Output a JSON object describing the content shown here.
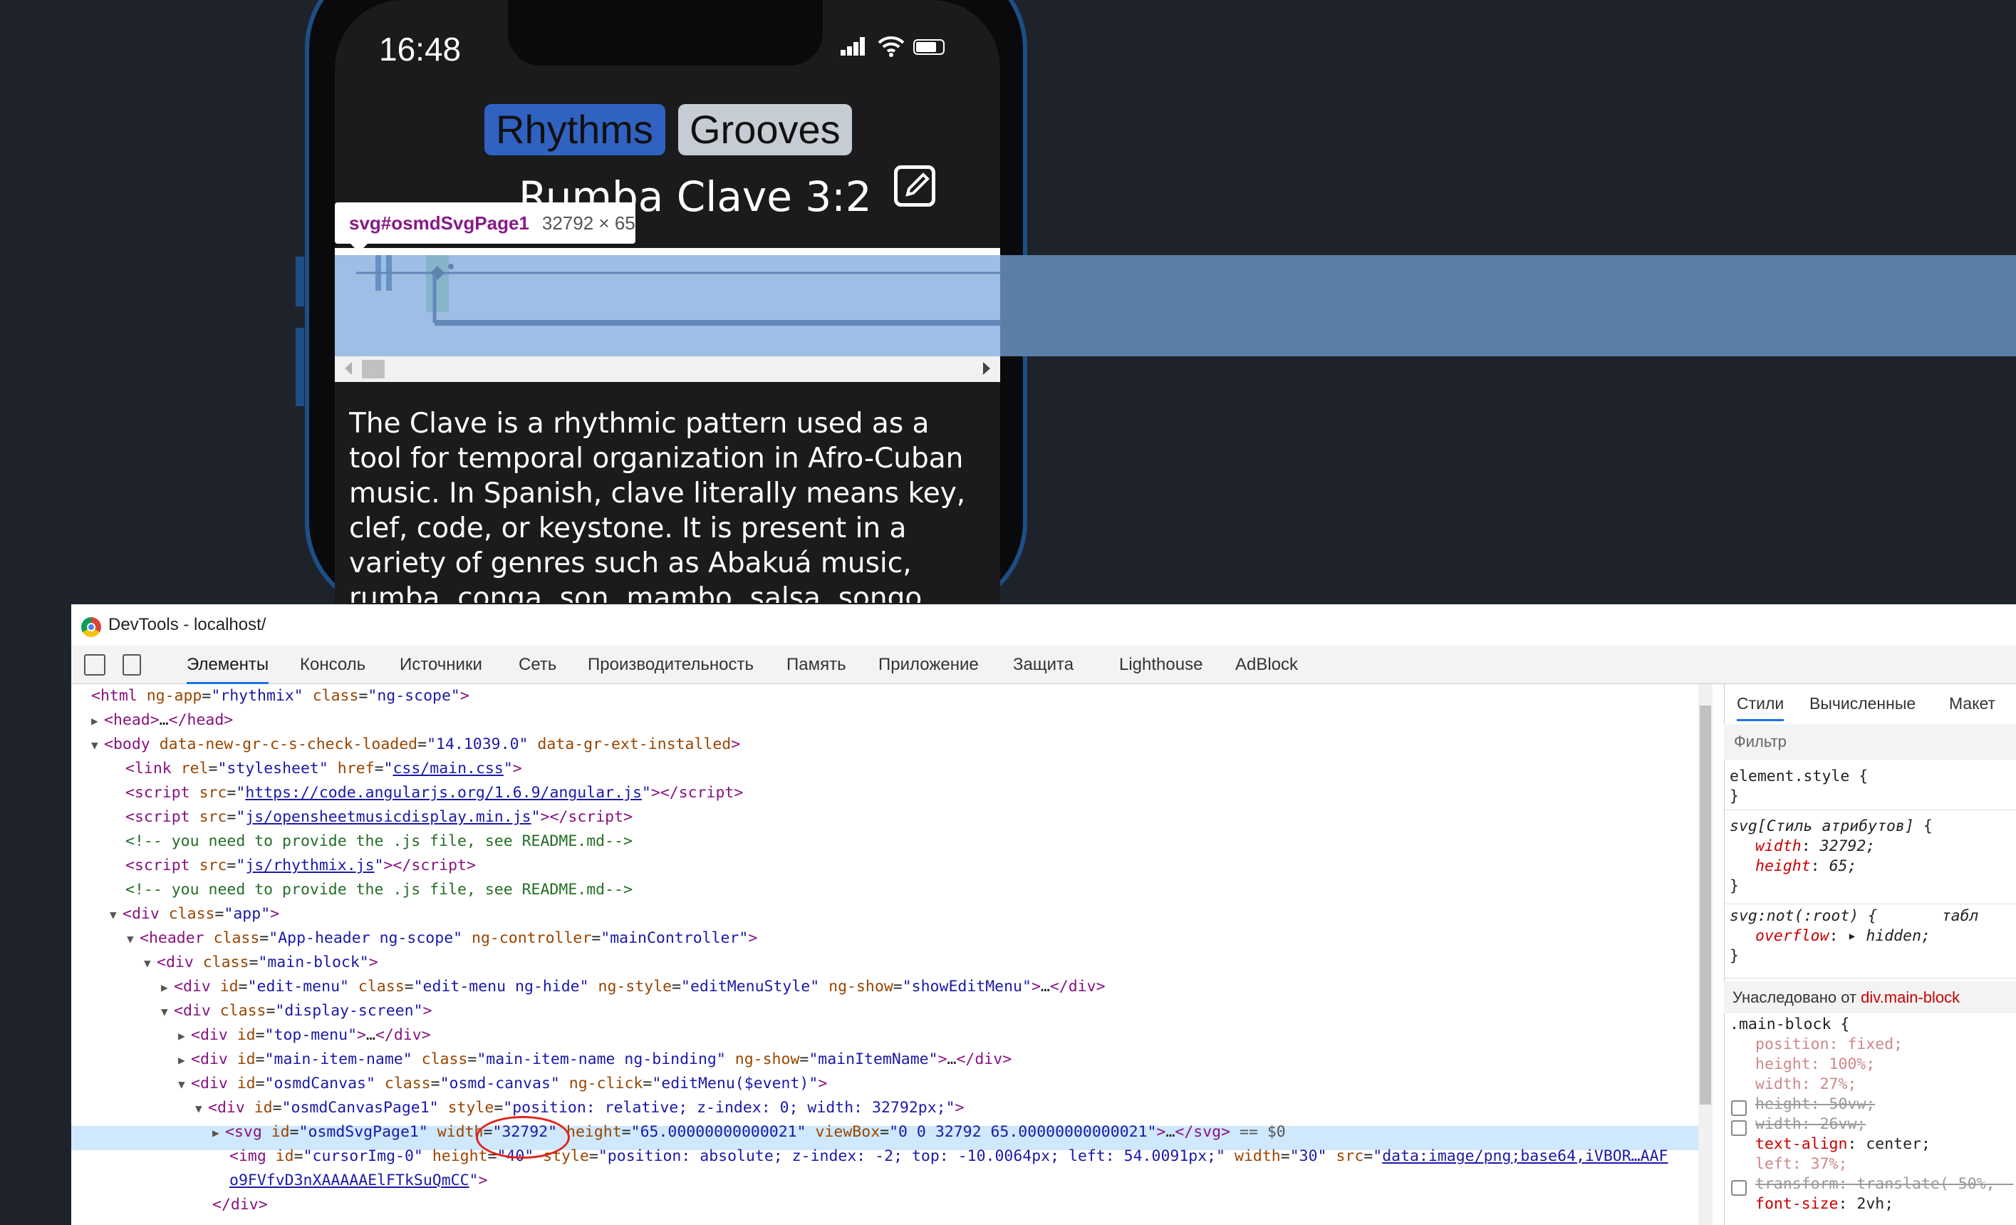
{
  "phone": {
    "time": "16:48",
    "tabs": [
      "Rhythms",
      "Grooves"
    ],
    "item_name": "Rumba Clave 3:2",
    "description": "The Clave is a rhythmic pattern used as a tool for temporal organization in Afro-Cuban music. In Spanish, clave literally means key, clef, code, or keystone. It is present in a variety of genres such as Abakuá music, rumba, conga, son, mambo, salsa, songo, timba and Afro-Cuban jazz. There are"
  },
  "tooltip": {
    "selector": "svg#osmdSvgPage1",
    "size": "32792 × 65"
  },
  "devtools": {
    "title": "DevTools - localhost/",
    "tabs": [
      "Элементы",
      "Консоль",
      "Источники",
      "Сеть",
      "Производительность",
      "Память",
      "Приложение",
      "Защита",
      "Lighthouse",
      "AdBlock"
    ]
  },
  "styles_panel": {
    "tabs": [
      "Стили",
      "Вычисленные",
      "Макет"
    ],
    "filter_placeholder": "Фильтр",
    "inherited_label": "Унаследовано от",
    "inherited_selector": "div.main-block"
  },
  "colors": {
    "tab_active": "#3062c2",
    "tab_inactive": "#c6ccd4",
    "selected_row": "#cfe8fc",
    "annotation": "#e0241c"
  }
}
